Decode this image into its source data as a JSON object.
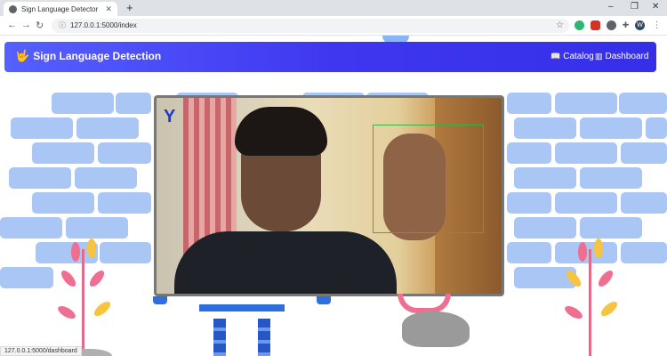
{
  "browser": {
    "tab_title": "Sign Language Detector",
    "tab_close": "✕",
    "new_tab": "+",
    "url": "127.0.0.1:5000/index",
    "minimize": "–",
    "maximize": "❐",
    "close": "✕",
    "back": "←",
    "forward": "→",
    "reload": "↻",
    "info": "ⓘ",
    "star": "☆",
    "ext_profile": "W",
    "menu": "⋮",
    "status_url": "127.0.0.1:5000/dashboard"
  },
  "navbar": {
    "brand": "Sign Language Detection",
    "links": [
      {
        "label": "Catalog",
        "icon": "book-icon"
      },
      {
        "label": "Dashboard",
        "icon": "columns-icon"
      }
    ],
    "colors": {
      "start": "#5560ff",
      "end": "#3530e8"
    }
  },
  "video": {
    "detected_letter": "Y"
  },
  "colors": {
    "brick": "#a9c6f5",
    "stand": "#2e6fe0",
    "detect_box": "#3cb043",
    "detected_letter": "#1a3bd6"
  }
}
